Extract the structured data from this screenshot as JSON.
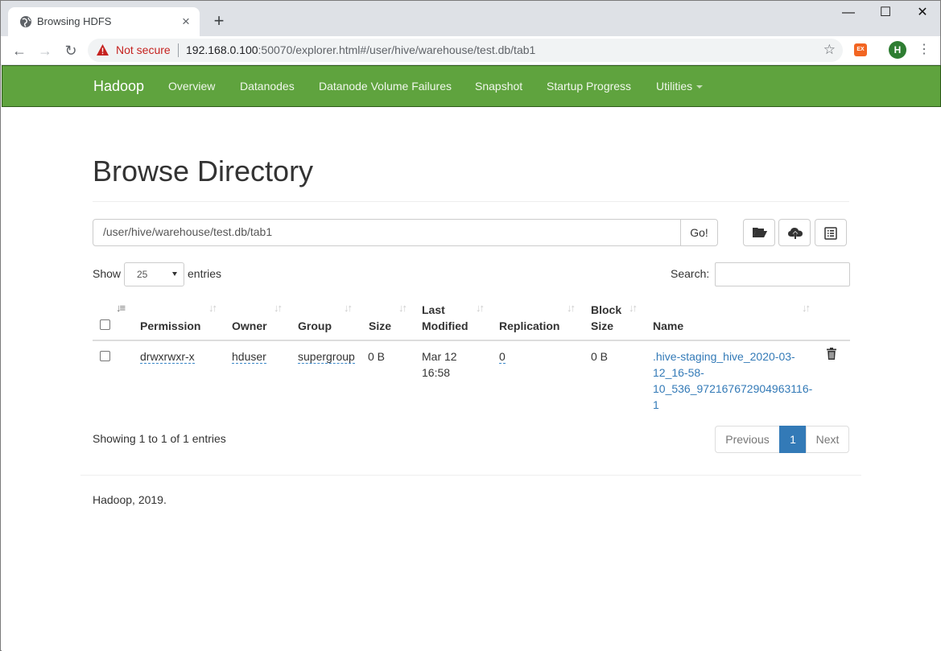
{
  "browser": {
    "tab_title": "Browsing HDFS",
    "new_tab": "+",
    "security_label": "Not secure",
    "url_host": "192.168.0.100",
    "url_rest": ":50070/explorer.html#/user/hive/warehouse/test.db/tab1",
    "avatar_letter": "H",
    "extension_label": "EX"
  },
  "navbar": {
    "brand": "Hadoop",
    "links": [
      "Overview",
      "Datanodes",
      "Datanode Volume Failures",
      "Snapshot",
      "Startup Progress",
      "Utilities"
    ]
  },
  "page": {
    "title": "Browse Directory",
    "path": "/user/hive/warehouse/test.db/tab1",
    "go_label": "Go!",
    "show_label": "Show",
    "entries_value": "25",
    "entries_label": "entries",
    "search_label": "Search:",
    "info": "Showing 1 to 1 of 1 entries",
    "pagination": {
      "previous": "Previous",
      "current": "1",
      "next": "Next"
    },
    "footer": "Hadoop, 2019."
  },
  "table": {
    "headers": {
      "permission": "Permission",
      "owner": "Owner",
      "group": "Group",
      "size": "Size",
      "last_modified_1": "Last",
      "last_modified_2": "Modified",
      "replication": "Replication",
      "block_size_1": "Block",
      "block_size_2": "Size",
      "name": "Name"
    },
    "rows": [
      {
        "permission": "drwxrwxr-x",
        "owner": "hduser",
        "group": "supergroup",
        "size": "0 B",
        "last_modified_1": "Mar 12",
        "last_modified_2": "16:58",
        "replication": "0",
        "block_size": "0 B",
        "name_lines": [
          ".hive-staging_hive_2020-03-",
          "12_16-58-",
          "10_536_972167672904963116-",
          "1"
        ]
      }
    ]
  }
}
